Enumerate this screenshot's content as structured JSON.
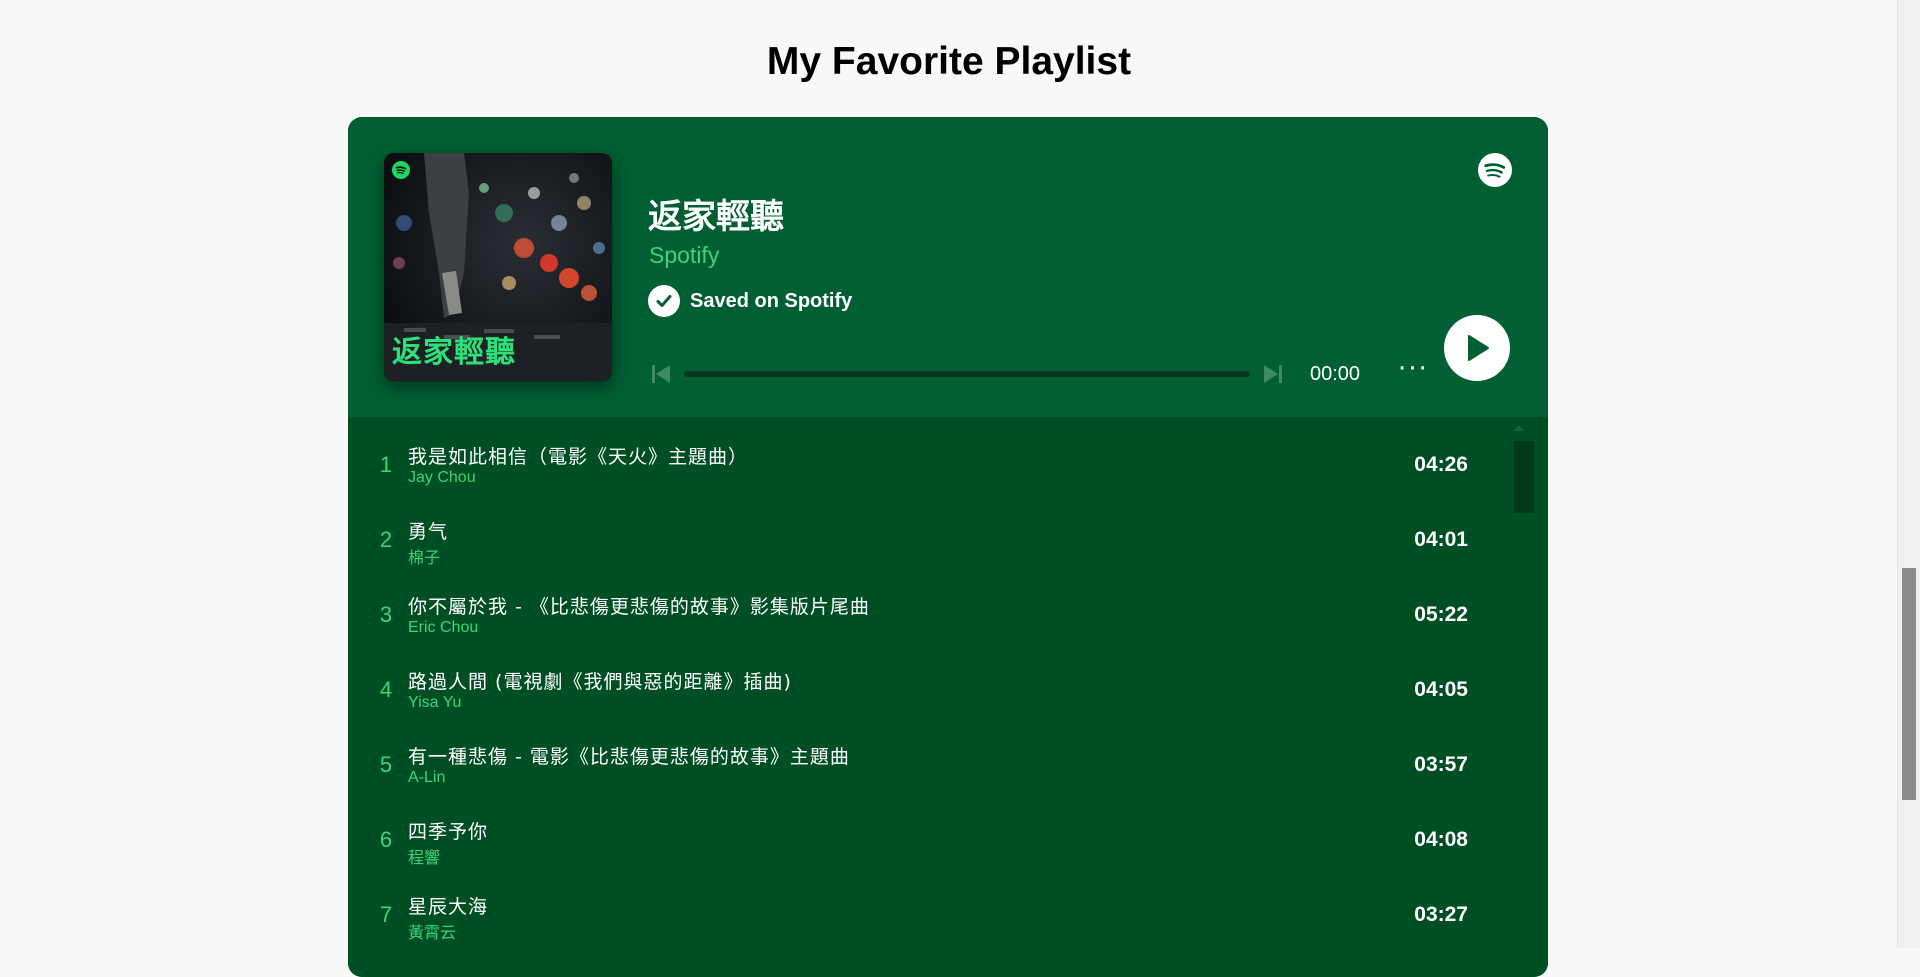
{
  "page": {
    "title": "My Favorite Playlist"
  },
  "player": {
    "playlist_name": "返家輕聽",
    "owner": "Spotify",
    "saved_text": "Saved on Spotify",
    "cover_title": "返家輕聽",
    "time": "00:00",
    "more_label": "···",
    "brand_color": "#005e32",
    "accent_color": "#3ed37b",
    "icons": {
      "logo": "spotify-icon",
      "saved": "check-circle-icon",
      "prev": "skip-previous-icon",
      "next": "skip-next-icon",
      "play": "play-icon",
      "more": "more-horizontal-icon"
    }
  },
  "tracks": [
    {
      "num": "1",
      "title": "我是如此相信（電影《天火》主題曲）",
      "artist": "Jay Chou",
      "duration": "04:26"
    },
    {
      "num": "2",
      "title": "勇气",
      "artist": "棉子",
      "duration": "04:01"
    },
    {
      "num": "3",
      "title": "你不屬於我 - 《比悲傷更悲傷的故事》影集版片尾曲",
      "artist": "Eric Chou",
      "duration": "05:22"
    },
    {
      "num": "4",
      "title": "路過人間 (電視劇《我們與惡的距離》插曲)",
      "artist": "Yisa Yu",
      "duration": "04:05"
    },
    {
      "num": "5",
      "title": "有一種悲傷 - 電影《比悲傷更悲傷的故事》主題曲",
      "artist": "A-Lin",
      "duration": "03:57"
    },
    {
      "num": "6",
      "title": "四季予你",
      "artist": "程響",
      "duration": "04:08"
    },
    {
      "num": "7",
      "title": "星辰大海",
      "artist": "黃霄云",
      "duration": "03:27"
    }
  ]
}
